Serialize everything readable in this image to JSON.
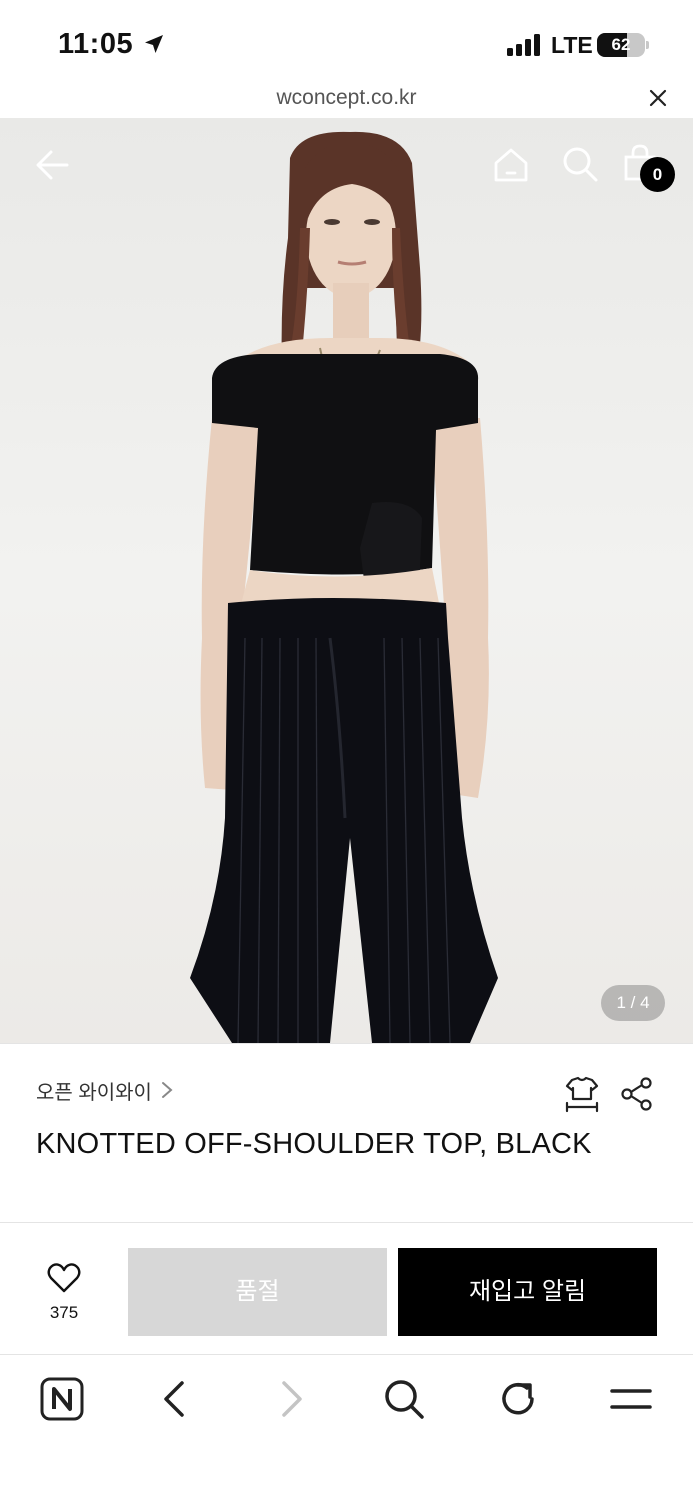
{
  "status_bar": {
    "time": "11:05",
    "network": "LTE",
    "battery": "62",
    "battery_level": 0.62
  },
  "url_bar": {
    "url": "wconcept.co.kr"
  },
  "hero": {
    "pager": "1 / 4",
    "cart_count": "0"
  },
  "product": {
    "brand": "오픈 와이와이",
    "title": "KNOTTED OFF-SHOULDER TOP, BLACK"
  },
  "actions": {
    "wish_count": "375",
    "soldout_label": "품절",
    "restock_label": "재입고 알림"
  },
  "icons": [
    "location-arrow-icon",
    "signal-icon",
    "battery-icon",
    "close-icon",
    "back-arrow-icon",
    "home-icon",
    "search-icon",
    "bag-icon",
    "chevron-right-icon",
    "size-guide-icon",
    "share-icon",
    "heart-icon",
    "naver-icon",
    "toolbar-back-icon",
    "toolbar-forward-icon",
    "toolbar-search-icon",
    "reload-icon",
    "menu-icon"
  ],
  "colors": {
    "primary_button": "#000000",
    "disabled_button": "#d7d7d7"
  }
}
